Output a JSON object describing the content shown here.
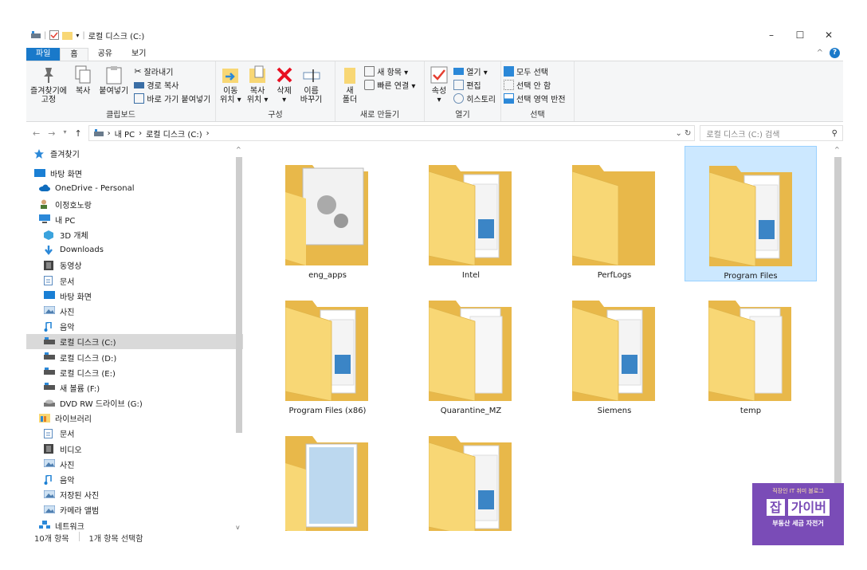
{
  "window": {
    "title": "로컬 디스크 (C:)"
  },
  "tabs": [
    {
      "label": "파일"
    },
    {
      "label": "홈"
    },
    {
      "label": "공유"
    },
    {
      "label": "보기"
    }
  ],
  "ribbon": {
    "clipboard": {
      "group_label": "클립보드",
      "pin_label_1": "즐겨찾기에",
      "pin_label_2": "고정",
      "copy_label": "복사",
      "paste_label": "붙여넣기",
      "cut_label": "잘라내기",
      "copy_path_label": "경로 복사",
      "paste_shortcut_label": "바로 가기 붙여넣기"
    },
    "organize": {
      "group_label": "구성",
      "move_label_1": "이동",
      "move_label_2": "위치 ▾",
      "copyto_label_1": "복사",
      "copyto_label_2": "위치 ▾",
      "delete_label_1": "삭제",
      "delete_label_2": "▾",
      "rename_label_1": "이름",
      "rename_label_2": "바꾸기"
    },
    "new": {
      "group_label": "새로 만들기",
      "newfolder_label_1": "새",
      "newfolder_label_2": "폴더",
      "newitem_label": "새 항목 ▾",
      "easyaccess_label": "빠른 연결 ▾"
    },
    "open": {
      "group_label": "열기",
      "properties_label_1": "속성",
      "properties_label_2": "▾",
      "open_label": "열기 ▾",
      "edit_label": "편집",
      "history_label": "히스토리"
    },
    "select": {
      "group_label": "선택",
      "selectall_label": "모두 선택",
      "selectnone_label": "선택 안 함",
      "invert_label": "선택 영역 반전"
    }
  },
  "address": {
    "crumb1": "내 PC",
    "crumb2": "로컬 디스크 (C:)",
    "search_placeholder": "로컬 디스크 (C:) 검색"
  },
  "nav": [
    {
      "label": "즐겨찾기",
      "icon": "star-icon",
      "indent": 0,
      "gap": true
    },
    {
      "label": "바탕 화면",
      "icon": "desktop-icon",
      "indent": 0,
      "gap": false
    },
    {
      "label": "OneDrive - Personal",
      "icon": "cloud-icon",
      "indent": 1
    },
    {
      "label": "이정호노랑",
      "icon": "user-icon",
      "indent": 1
    },
    {
      "label": "내 PC",
      "icon": "pc-icon",
      "indent": 1
    },
    {
      "label": "3D 개체",
      "icon": "cube-icon",
      "indent": 2
    },
    {
      "label": "Downloads",
      "icon": "download-icon",
      "indent": 2
    },
    {
      "label": "동영상",
      "icon": "video-icon",
      "indent": 2
    },
    {
      "label": "문서",
      "icon": "document-icon",
      "indent": 2
    },
    {
      "label": "바탕 화면",
      "icon": "desktop-icon",
      "indent": 2
    },
    {
      "label": "사진",
      "icon": "picture-icon",
      "indent": 2
    },
    {
      "label": "음악",
      "icon": "music-icon",
      "indent": 2
    },
    {
      "label": "로컬 디스크 (C:)",
      "icon": "drive-icon",
      "indent": 2,
      "selected": true
    },
    {
      "label": "로컬 디스크 (D:)",
      "icon": "drive-icon",
      "indent": 2
    },
    {
      "label": "로컬 디스크 (E:)",
      "icon": "drive-icon",
      "indent": 2
    },
    {
      "label": "새 볼륨 (F:)",
      "icon": "drive-icon",
      "indent": 2
    },
    {
      "label": "DVD RW 드라이브 (G:)",
      "icon": "dvd-icon",
      "indent": 2
    },
    {
      "label": "라이브러리",
      "icon": "library-icon",
      "indent": 1
    },
    {
      "label": "문서",
      "icon": "document-icon",
      "indent": 2
    },
    {
      "label": "비디오",
      "icon": "video-icon",
      "indent": 2
    },
    {
      "label": "사진",
      "icon": "picture-icon",
      "indent": 2
    },
    {
      "label": "음악",
      "icon": "music-icon",
      "indent": 2
    },
    {
      "label": "저장된 사진",
      "icon": "picture-icon",
      "indent": 2
    },
    {
      "label": "카메라 앨범",
      "icon": "picture-icon",
      "indent": 2
    },
    {
      "label": "네트워크",
      "icon": "network-icon",
      "indent": 1
    }
  ],
  "folders": [
    {
      "name": "eng_apps",
      "kind": "gears"
    },
    {
      "name": "Intel",
      "kind": "docs"
    },
    {
      "name": "PerfLogs",
      "kind": "empty"
    },
    {
      "name": "Program Files",
      "kind": "docs",
      "selected": true
    },
    {
      "name": "Program Files (x86)",
      "kind": "docs"
    },
    {
      "name": "Quarantine_MZ",
      "kind": "papers"
    },
    {
      "name": "Siemens",
      "kind": "docs"
    },
    {
      "name": "temp",
      "kind": "papers"
    },
    {
      "name": "",
      "kind": "notepad"
    },
    {
      "name": "",
      "kind": "docs"
    }
  ],
  "status": {
    "count": "10개 항목",
    "selected": "1개 항목 선택함"
  },
  "watermark": {
    "top": "직장인 IT 취미 블로그",
    "badge1": "잡",
    "badge2": "가이버",
    "bottom": "부동산 세금 자전거"
  },
  "colors": {
    "accent": "#1979ca",
    "selection": "#cce8ff",
    "folder": "#f8d775"
  }
}
